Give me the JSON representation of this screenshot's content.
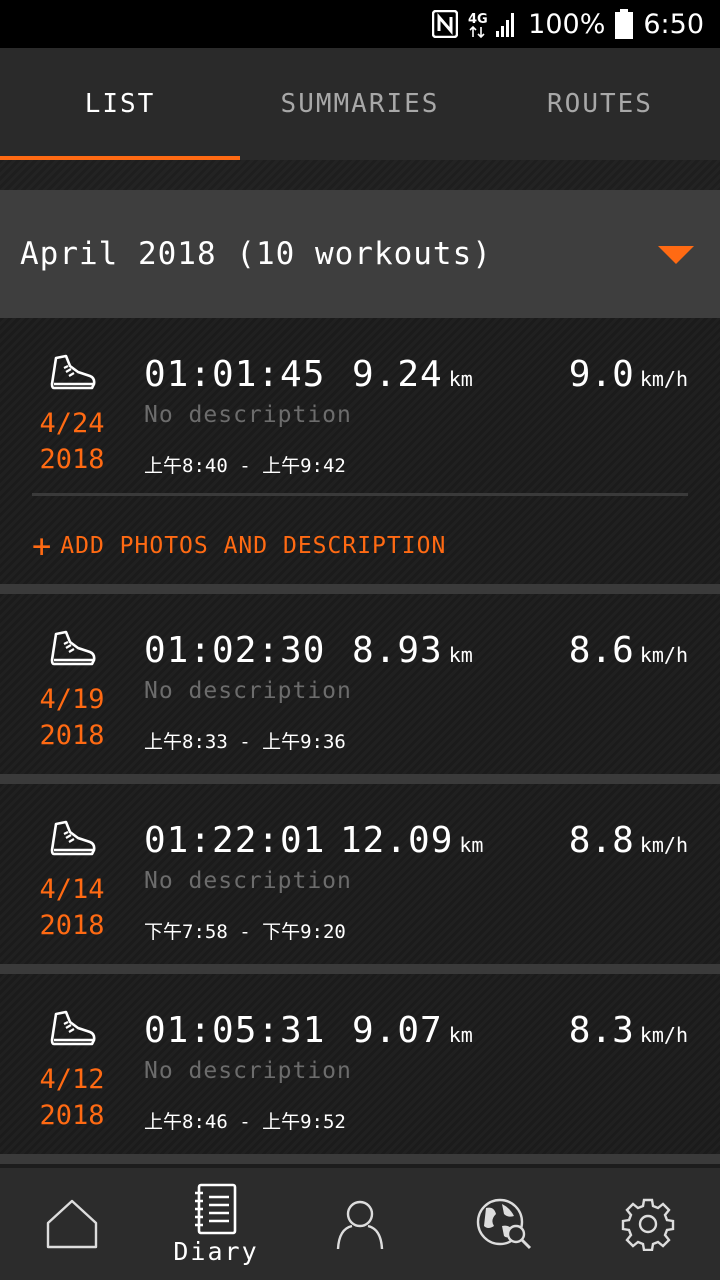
{
  "status_bar": {
    "nfc_icon": "nfc-icon",
    "network": "4G",
    "battery": "100%",
    "time": "6:50"
  },
  "tabs": [
    {
      "label": "LIST",
      "active": true
    },
    {
      "label": "SUMMARIES",
      "active": false
    },
    {
      "label": "ROUTES",
      "active": false
    }
  ],
  "month_header": {
    "label": "April 2018 (10 workouts)",
    "icon": "dropdown-caret-icon"
  },
  "workouts": [
    {
      "date_md": "4/24",
      "date_year": "2018",
      "duration": "01:01:45",
      "distance": "9.24",
      "distance_unit": "km",
      "speed": "9.0",
      "speed_unit": "km/h",
      "description": "No description",
      "time_range": "上午8:40 - 上午9:42",
      "add_action": "ADD PHOTOS AND DESCRIPTION"
    },
    {
      "date_md": "4/19",
      "date_year": "2018",
      "duration": "01:02:30",
      "distance": "8.93",
      "distance_unit": "km",
      "speed": "8.6",
      "speed_unit": "km/h",
      "description": "No description",
      "time_range": "上午8:33 - 上午9:36"
    },
    {
      "date_md": "4/14",
      "date_year": "2018",
      "duration": "01:22:01",
      "distance": "12.09",
      "distance_unit": "km",
      "speed": "8.8",
      "speed_unit": "km/h",
      "description": "No description",
      "time_range": "下午7:58 - 下午9:20"
    },
    {
      "date_md": "4/12",
      "date_year": "2018",
      "duration": "01:05:31",
      "distance": "9.07",
      "distance_unit": "km",
      "speed": "8.3",
      "speed_unit": "km/h",
      "description": "No description",
      "time_range": "上午8:46 - 上午9:52"
    }
  ],
  "bottom_nav": [
    {
      "icon": "home-icon",
      "label": ""
    },
    {
      "icon": "diary-icon",
      "label": "Diary",
      "active": true
    },
    {
      "icon": "profile-icon",
      "label": ""
    },
    {
      "icon": "explore-globe-icon",
      "label": ""
    },
    {
      "icon": "settings-gear-icon",
      "label": ""
    }
  ],
  "colors": {
    "accent": "#ff6a13",
    "background": "#1c1c1c",
    "header": "#3e3e3e",
    "muted_text": "#6c6c6c"
  }
}
